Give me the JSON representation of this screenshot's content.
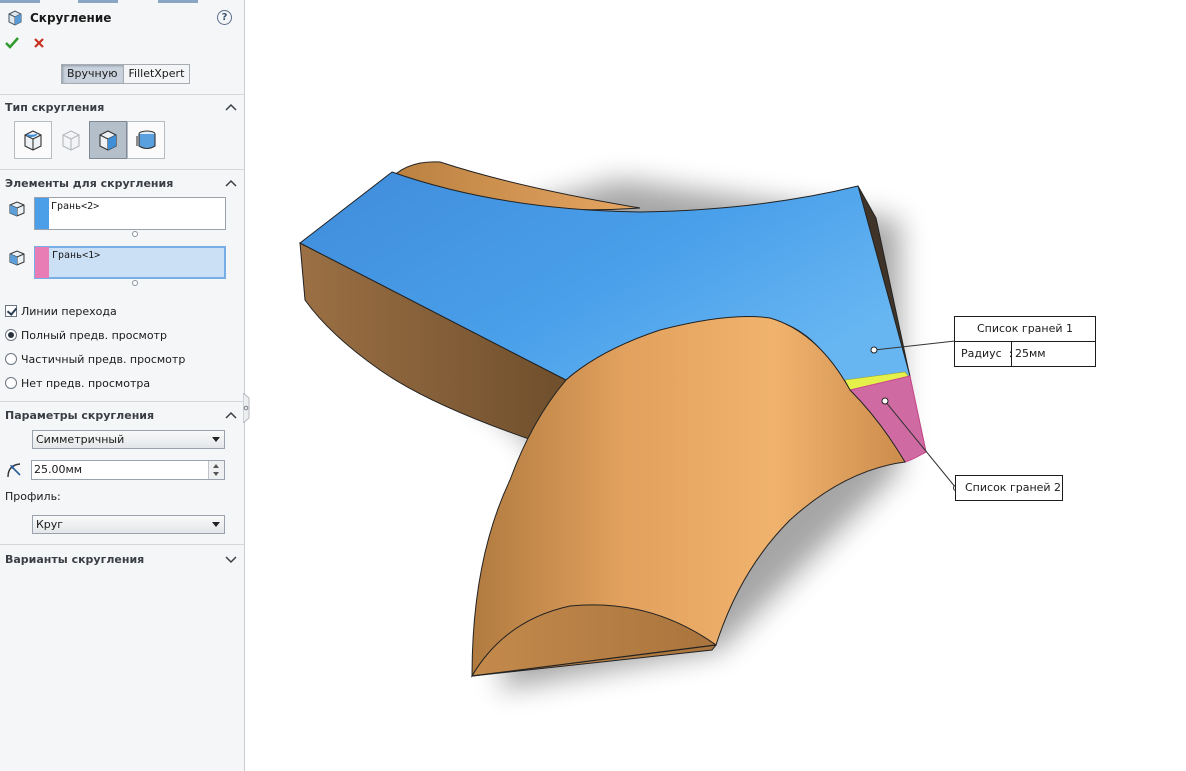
{
  "header": {
    "title": "Скругление",
    "help": "?"
  },
  "mode_tabs": {
    "manual": "Вручную",
    "filletxpert": "FilletXpert"
  },
  "sections": {
    "fillet_type": "Тип скругления",
    "items": "Элементы для скругления",
    "parameters": "Параметры скругления",
    "variants": "Варианты скругления"
  },
  "face_sets": [
    {
      "label": "Грань<2>",
      "color": "#4a9fe8"
    },
    {
      "label": "Грань<1>",
      "color": "#e87cb4"
    }
  ],
  "options": {
    "tangent_lines": "Линии перехода",
    "full_preview": "Полный предв. просмотр",
    "partial_preview": "Частичный предв. просмотр",
    "no_preview": "Нет предв. просмотра"
  },
  "parameters": {
    "method": "Симметричный",
    "radius": "25.00мм",
    "profile_label": "Профиль:",
    "profile": "Круг"
  },
  "callouts": {
    "face_list_1": "Список граней 1",
    "radius_label": "Радиус",
    "radius_sep": ":",
    "radius_value": "25мм",
    "face_list_2": "Список граней 2"
  },
  "colors": {
    "blue_face": "#4a9fe8",
    "pink_face": "#e87cb4",
    "body": "#e1a05e"
  }
}
